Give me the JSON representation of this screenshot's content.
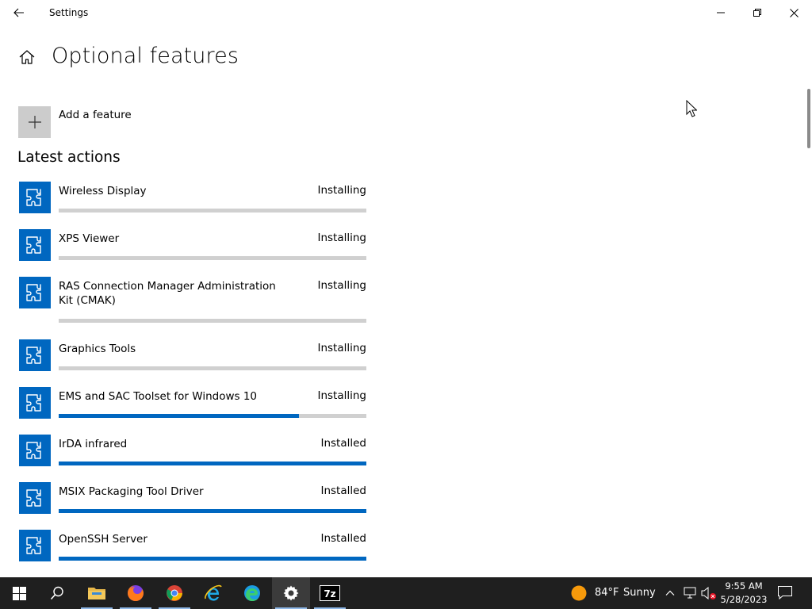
{
  "window": {
    "title": "Settings"
  },
  "header": {
    "title": "Optional features"
  },
  "add_feature": {
    "label": "Add a feature"
  },
  "latest_actions": {
    "title": "Latest actions",
    "items": [
      {
        "name": "Wireless Display",
        "status": "Installing",
        "progress": 0.0
      },
      {
        "name": "XPS Viewer",
        "status": "Installing",
        "progress": 0.0
      },
      {
        "name": "RAS Connection Manager Administration Kit (CMAK)",
        "status": "Installing",
        "progress": 0.0
      },
      {
        "name": "Graphics Tools",
        "status": "Installing",
        "progress": 0.0
      },
      {
        "name": "EMS and SAC Toolset for Windows 10",
        "status": "Installing",
        "progress": 0.78
      },
      {
        "name": "IrDA infrared",
        "status": "Installed",
        "progress": 1.0
      },
      {
        "name": "MSIX Packaging Tool Driver",
        "status": "Installed",
        "progress": 1.0
      },
      {
        "name": "OpenSSH Server",
        "status": "Installed",
        "progress": 1.0
      }
    ]
  },
  "taskbar": {
    "apps": [
      {
        "name": "start",
        "icon": "windows-logo-icon"
      },
      {
        "name": "search",
        "icon": "search-icon"
      },
      {
        "name": "file-explorer",
        "icon": "folder-icon"
      },
      {
        "name": "firefox",
        "icon": "firefox-icon"
      },
      {
        "name": "chrome",
        "icon": "chrome-icon"
      },
      {
        "name": "internet-explorer",
        "icon": "ie-icon"
      },
      {
        "name": "edge",
        "icon": "edge-icon"
      },
      {
        "name": "settings",
        "icon": "gear-icon"
      },
      {
        "name": "7zip",
        "icon": "7zip-icon"
      }
    ],
    "weather": {
      "temp": "84°F",
      "condition": "Sunny"
    },
    "clock": {
      "time": "9:55 AM",
      "date": "5/28/2023"
    }
  },
  "colors": {
    "accent": "#0067c0",
    "taskbar": "#1f1f1f",
    "bar_track": "#d0d0d0"
  }
}
